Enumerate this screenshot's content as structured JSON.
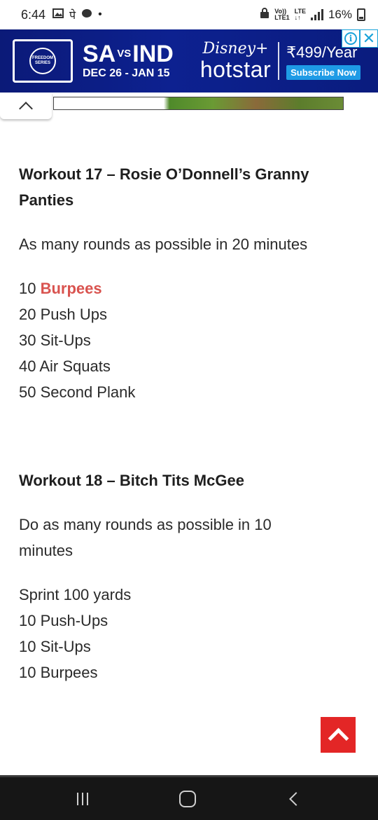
{
  "status_bar": {
    "time": "6:44",
    "notification_glyph": "पे",
    "network_top": "Vo))",
    "network_bottom": "LTE1",
    "lte_top": "LTE",
    "lte_bottom": "↓↑",
    "battery": "16%"
  },
  "ad": {
    "logo_line1": "FREEDOM",
    "logo_line2": "SERIES",
    "team_a": "SA",
    "vs": "VS",
    "team_b": "IND",
    "dates": "DEC 26 - JAN 15",
    "disney": "Disney+",
    "hotstar": "hotstar",
    "price": "₹499/Year",
    "subscribe": "Subscribe Now",
    "info_label": "i",
    "close_label": "✕"
  },
  "article": {
    "workout17": {
      "title_line1": "Workout 17 – Rosie O’Donnell’s Granny",
      "title_line2": "Panties",
      "description": "As many rounds as possible in 20 minutes",
      "item1_count": "10 ",
      "item1_link": "Burpees",
      "item2": "20 Push Ups",
      "item3": "30 Sit-Ups",
      "item4": "40 Air Squats",
      "item5": "50 Second Plank"
    },
    "workout18": {
      "title": "Workout 18 – Bitch Tits McGee",
      "description_line1": "Do as many rounds as possible in 10",
      "description_line2": "minutes",
      "item1": "Sprint 100 yards",
      "item2": "10 Push-Ups",
      "item3": "10 Sit-Ups",
      "item4": "10 Burpees"
    }
  },
  "colors": {
    "link": "#d9534f",
    "scroll_top": "#e32626",
    "ad_background": "#0d2190",
    "subscribe": "#1e9be6"
  }
}
